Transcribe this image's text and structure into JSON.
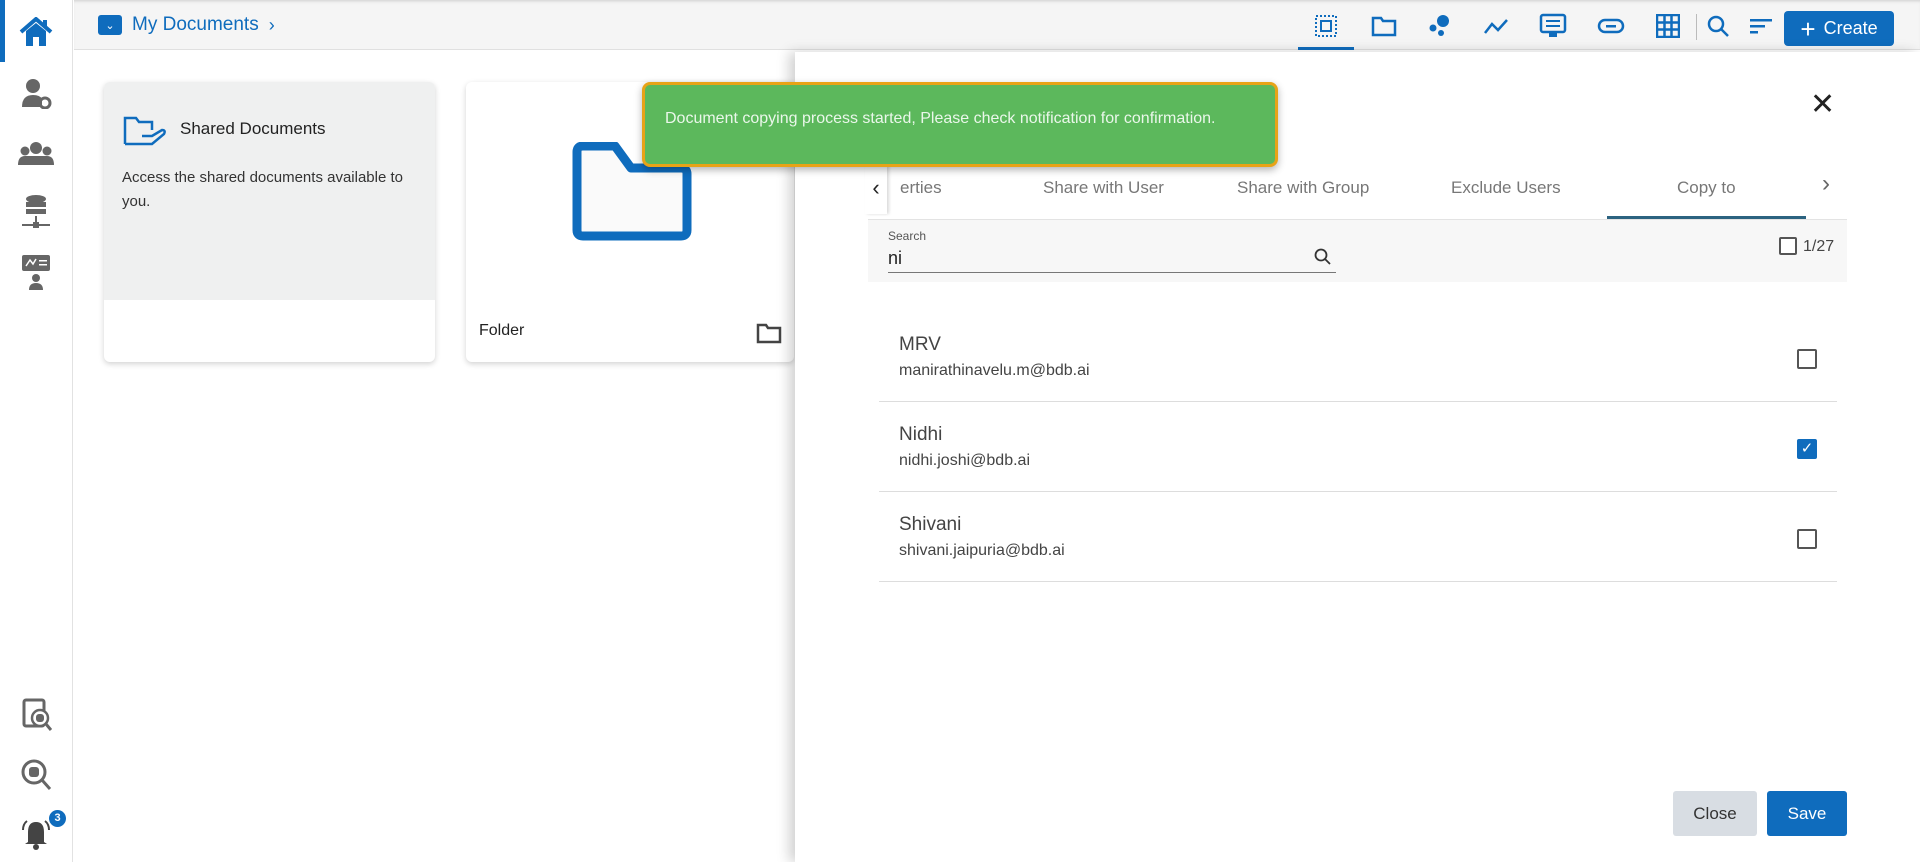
{
  "breadcrumb": {
    "label": "My Documents"
  },
  "toolbar": {
    "create_label": "Create"
  },
  "notifications": {
    "count": "3"
  },
  "cards": [
    {
      "title": "Shared Documents",
      "description": "Access the shared documents available to you."
    },
    {
      "title": "Folder"
    }
  ],
  "toast": {
    "message": "Document copying process started, Please check notification for confirmation."
  },
  "panel": {
    "tabs": [
      {
        "label": "erties"
      },
      {
        "label": "Share with User"
      },
      {
        "label": "Share with Group"
      },
      {
        "label": "Exclude Users"
      },
      {
        "label": "Copy to"
      }
    ],
    "active_tab": "Copy to",
    "search": {
      "label": "Search",
      "value": "ni"
    },
    "selection_count": "1/27",
    "users": [
      {
        "name": "MRV",
        "email": "manirathinavelu.m@bdb.ai",
        "checked": false
      },
      {
        "name": "Nidhi",
        "email": "nidhi.joshi@bdb.ai",
        "checked": true
      },
      {
        "name": "Shivani",
        "email": "shivani.jaipuria@bdb.ai",
        "checked": false
      }
    ],
    "close_label": "Close",
    "save_label": "Save"
  },
  "colors": {
    "accent": "#0f6cbd",
    "toast": "#5cb85c",
    "toast_border": "#e8a317"
  }
}
